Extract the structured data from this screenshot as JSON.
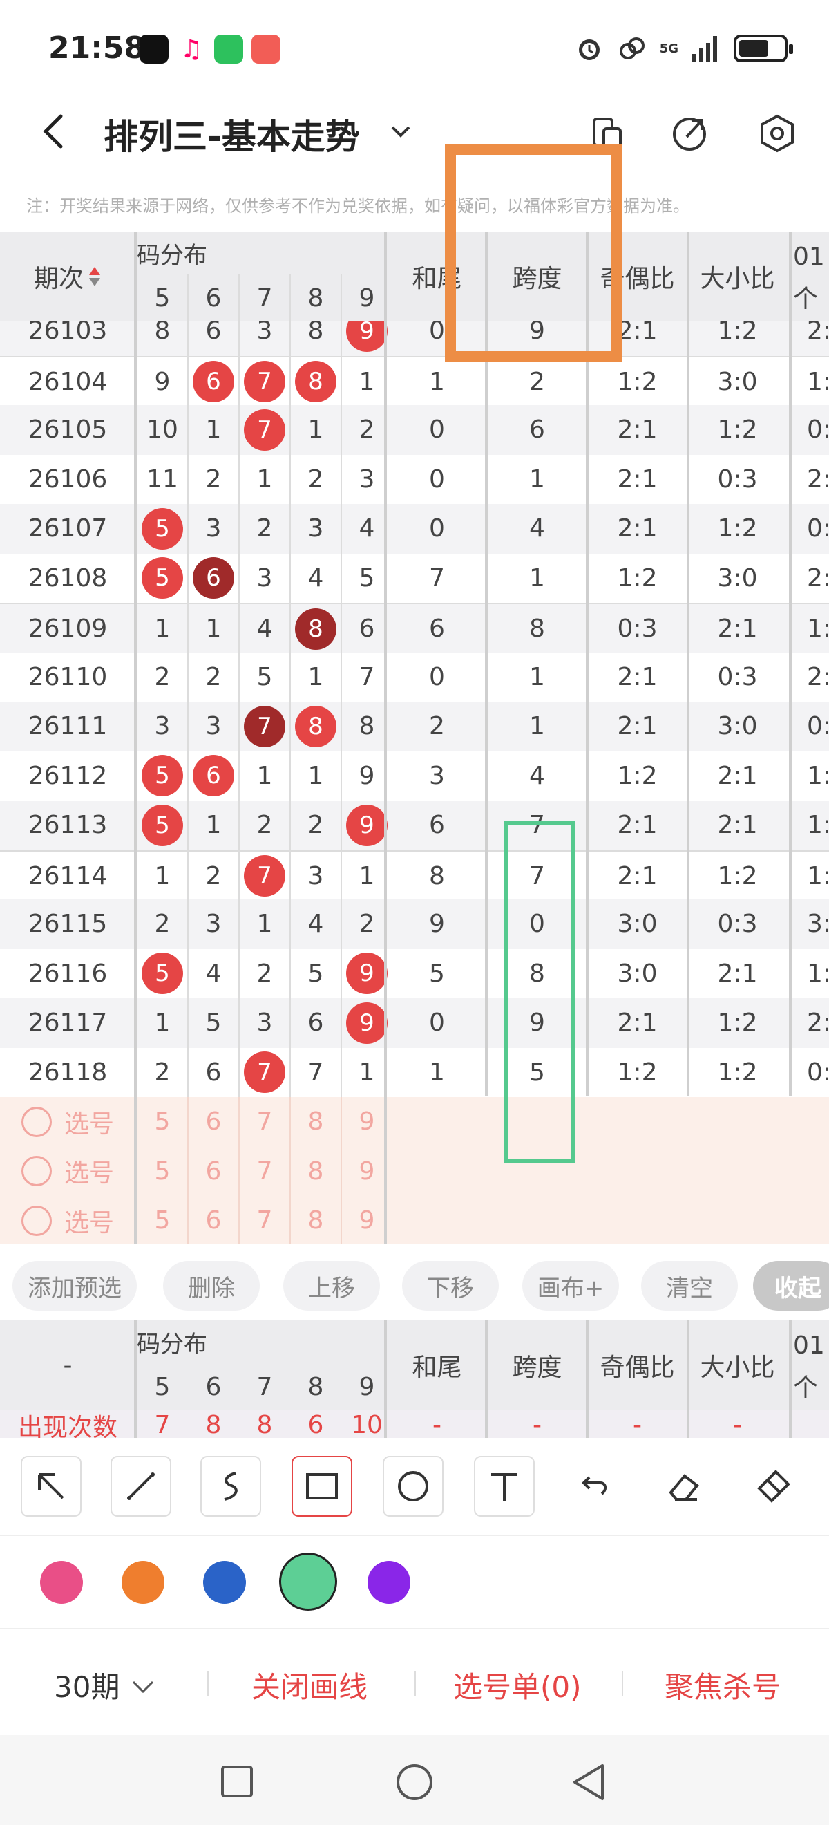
{
  "status_bar": {
    "time": "21:58",
    "network": "5G",
    "apps": [
      "tiktok-icon",
      "music-icon",
      "wechat-icon",
      "app-icon"
    ]
  },
  "header": {
    "title": "排列三-基本走势",
    "icons": [
      "back-icon",
      "chevron-down-icon",
      "copy-icon",
      "share-icon",
      "settings-icon"
    ]
  },
  "notice": "注：开奖结果来源于网络，仅供参考不作为兑奖依据，如有疑问，以福体彩官方数据为准。",
  "table": {
    "header": {
      "period_label": "期次",
      "dist_label": "码分布",
      "digits": [
        "5",
        "6",
        "7",
        "8",
        "9"
      ],
      "sum_tail": "和尾",
      "span": "跨度",
      "odd_even": "奇偶比",
      "big_small": "大小比",
      "extra_top": "01",
      "extra_bottom": "个"
    },
    "rows": [
      {
        "period": "26103",
        "d": [
          "8",
          "6",
          "3",
          "8",
          "9"
        ],
        "hot": [
          0,
          0,
          0,
          0,
          1
        ],
        "sum": "0",
        "span": "9",
        "oe": "2:1",
        "bs": "1:2",
        "x": "2:"
      },
      {
        "period": "26104",
        "d": [
          "9",
          "6",
          "7",
          "8",
          "1"
        ],
        "hot": [
          0,
          1,
          1,
          1,
          0
        ],
        "sum": "1",
        "span": "2",
        "oe": "1:2",
        "bs": "3:0",
        "x": "1:"
      },
      {
        "period": "26105",
        "d": [
          "10",
          "1",
          "7",
          "1",
          "2"
        ],
        "hot": [
          0,
          0,
          1,
          0,
          0
        ],
        "sum": "0",
        "span": "6",
        "oe": "2:1",
        "bs": "1:2",
        "x": "0:"
      },
      {
        "period": "26106",
        "d": [
          "11",
          "2",
          "1",
          "2",
          "3"
        ],
        "hot": [
          0,
          0,
          0,
          0,
          0
        ],
        "sum": "0",
        "span": "1",
        "oe": "2:1",
        "bs": "0:3",
        "x": "2:"
      },
      {
        "period": "26107",
        "d": [
          "5",
          "3",
          "2",
          "3",
          "4"
        ],
        "hot": [
          1,
          0,
          0,
          0,
          0
        ],
        "sum": "0",
        "span": "4",
        "oe": "2:1",
        "bs": "1:2",
        "x": "0:"
      },
      {
        "period": "26108",
        "d": [
          "5",
          "6",
          "3",
          "4",
          "5"
        ],
        "hot": [
          1,
          2,
          0,
          0,
          0
        ],
        "sum": "7",
        "span": "1",
        "oe": "1:2",
        "bs": "3:0",
        "x": "2:"
      },
      {
        "period": "26109",
        "d": [
          "1",
          "1",
          "4",
          "8",
          "6"
        ],
        "hot": [
          0,
          0,
          0,
          2,
          0
        ],
        "sum": "6",
        "span": "8",
        "oe": "0:3",
        "bs": "2:1",
        "x": "1:"
      },
      {
        "period": "26110",
        "d": [
          "2",
          "2",
          "5",
          "1",
          "7"
        ],
        "hot": [
          0,
          0,
          0,
          0,
          0
        ],
        "sum": "0",
        "span": "1",
        "oe": "2:1",
        "bs": "0:3",
        "x": "2:"
      },
      {
        "period": "26111",
        "d": [
          "3",
          "3",
          "7",
          "8",
          "8"
        ],
        "hot": [
          0,
          0,
          2,
          1,
          0
        ],
        "sum": "2",
        "span": "1",
        "oe": "2:1",
        "bs": "3:0",
        "x": "0:"
      },
      {
        "period": "26112",
        "d": [
          "5",
          "6",
          "1",
          "1",
          "9"
        ],
        "hot": [
          1,
          1,
          0,
          0,
          0
        ],
        "sum": "3",
        "span": "4",
        "oe": "1:2",
        "bs": "2:1",
        "x": "1:"
      },
      {
        "period": "26113",
        "d": [
          "5",
          "1",
          "2",
          "2",
          "9"
        ],
        "hot": [
          1,
          0,
          0,
          0,
          1
        ],
        "sum": "6",
        "span": "7",
        "oe": "2:1",
        "bs": "2:1",
        "x": "1:"
      },
      {
        "period": "26114",
        "d": [
          "1",
          "2",
          "7",
          "3",
          "1"
        ],
        "hot": [
          0,
          0,
          1,
          0,
          0
        ],
        "sum": "8",
        "span": "7",
        "oe": "2:1",
        "bs": "1:2",
        "x": "1:"
      },
      {
        "period": "26115",
        "d": [
          "2",
          "3",
          "1",
          "4",
          "2"
        ],
        "hot": [
          0,
          0,
          0,
          0,
          0
        ],
        "sum": "9",
        "span": "0",
        "oe": "3:0",
        "bs": "0:3",
        "x": "3:"
      },
      {
        "period": "26116",
        "d": [
          "5",
          "4",
          "2",
          "5",
          "9"
        ],
        "hot": [
          1,
          0,
          0,
          0,
          1
        ],
        "sum": "5",
        "span": "8",
        "oe": "3:0",
        "bs": "2:1",
        "x": "1:"
      },
      {
        "period": "26117",
        "d": [
          "1",
          "5",
          "3",
          "6",
          "9"
        ],
        "hot": [
          0,
          0,
          0,
          0,
          1
        ],
        "sum": "0",
        "span": "9",
        "oe": "2:1",
        "bs": "1:2",
        "x": "2:"
      },
      {
        "period": "26118",
        "d": [
          "2",
          "6",
          "7",
          "7",
          "1"
        ],
        "hot": [
          0,
          0,
          1,
          0,
          0
        ],
        "sum": "1",
        "span": "5",
        "oe": "1:2",
        "bs": "1:2",
        "x": "0:"
      }
    ],
    "pick_rows": [
      {
        "label": "选号",
        "d": [
          "5",
          "6",
          "7",
          "8",
          "9"
        ]
      },
      {
        "label": "选号",
        "d": [
          "5",
          "6",
          "7",
          "8",
          "9"
        ]
      },
      {
        "label": "选号",
        "d": [
          "5",
          "6",
          "7",
          "8",
          "9"
        ]
      }
    ]
  },
  "actions": [
    "添加预选",
    "删除",
    "上移",
    "下移",
    "画布+",
    "清空",
    "收起"
  ],
  "stats_table": {
    "period_label": "-",
    "dist_label": "码分布",
    "digits": [
      "5",
      "6",
      "7",
      "8",
      "9"
    ],
    "sum_tail": "和尾",
    "span": "跨度",
    "odd_even": "奇偶比",
    "big_small": "大小比",
    "extra_top": "01",
    "extra_bottom": "个",
    "count_label": "出现次数",
    "counts": [
      "7",
      "8",
      "8",
      "6",
      "10"
    ],
    "rest": [
      "-",
      "-",
      "-",
      "-"
    ]
  },
  "draw_tools": [
    "arrow-tool-icon",
    "line-tool-icon",
    "freehand-tool-icon",
    "rectangle-tool-icon",
    "circle-tool-icon",
    "text-tool-icon",
    "undo-icon",
    "eraser-icon",
    "clear-brush-icon"
  ],
  "palette": {
    "colors": [
      "#e94f87",
      "#ef7e2e",
      "#2a63c8",
      "#5dcf95",
      "#8a26e8"
    ],
    "selected": 3
  },
  "bottom": {
    "periods": "30期",
    "close_lines": "关闭画线",
    "pick_list": "选号单(0)",
    "focus_kill": "聚焦杀号"
  },
  "annotations": {
    "orange_rect_color": "#ed8d45",
    "green_rect_color": "#55c98e"
  }
}
